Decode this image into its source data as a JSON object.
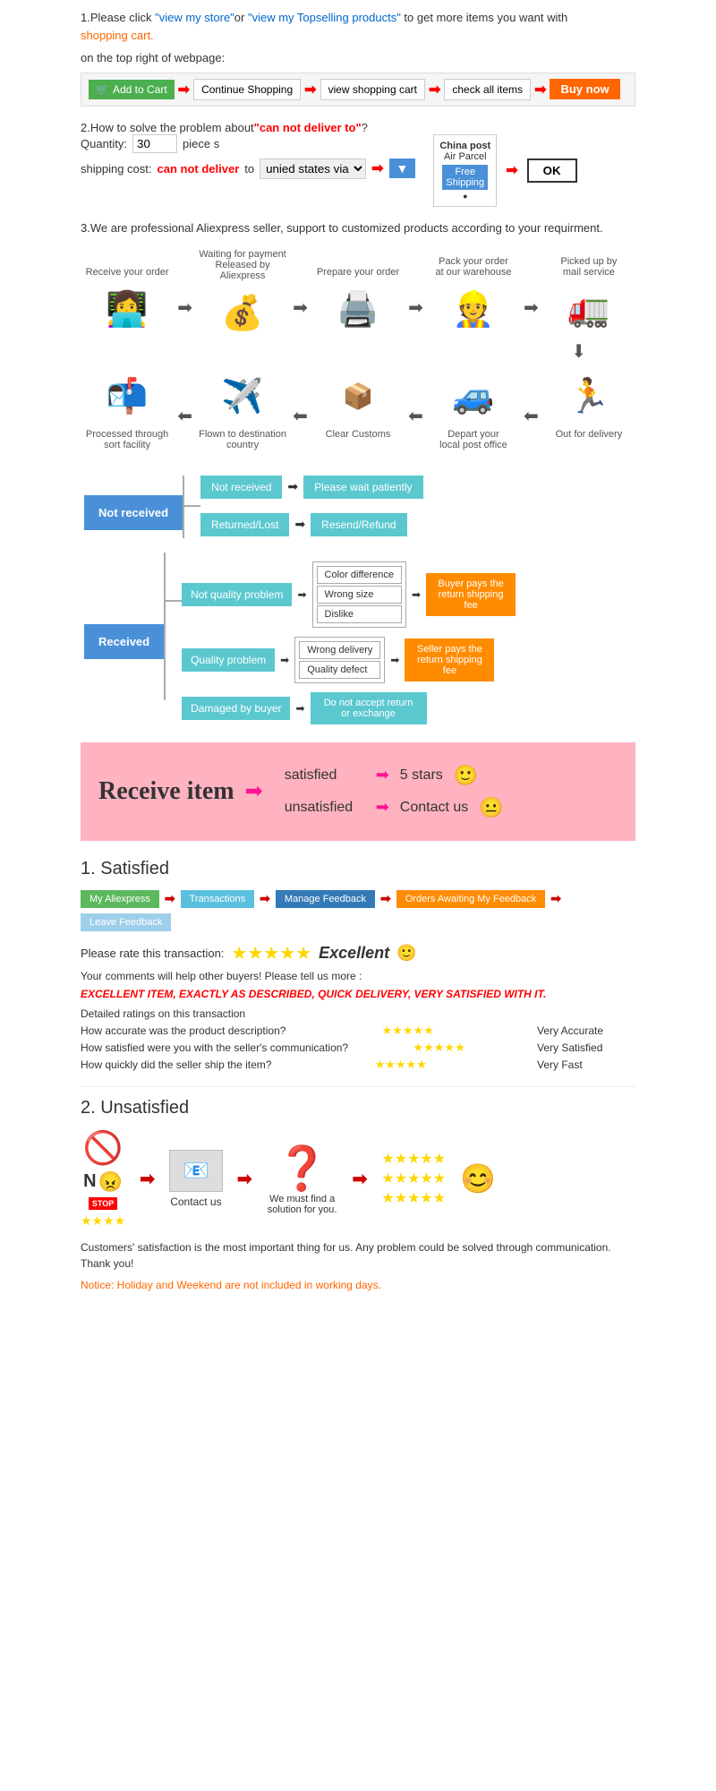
{
  "section1": {
    "text1": "1.Please click ",
    "link1": "\"view my store\"",
    "text2": "or ",
    "link2": "\"view my Topselling products\"",
    "text3": " to get more items you want with",
    "link3": "shopping cart.",
    "text4": "on the top right of webpage:",
    "cart_btn": "Add to Cart",
    "continue_btn": "Continue Shopping",
    "view_cart_btn": "view shopping cart",
    "check_btn": "check all items",
    "buy_btn": "Buy now"
  },
  "section2": {
    "title": "2.How to solve the problem about",
    "cannot": "\"can not deliver to\"",
    "text": "?",
    "quantity_label": "Quantity:",
    "quantity_value": "30",
    "pieces": "piece s",
    "shipping_label": "shipping cost:",
    "can_not": "can not deliver",
    "to": " to ",
    "via": "unied states via",
    "china_post_title": "China post",
    "china_post_sub": "Air Parcel",
    "free_shipping": "Free",
    "shipping_word": "Shipping",
    "ok": "OK"
  },
  "section3": {
    "text": "3.We are professional Aliexpress seller, support to customized products according to your requirment."
  },
  "process_row1": {
    "labels": [
      "Receive your order",
      "Waiting for payment Released by Aliexpress",
      "Prepare your order",
      "Pack your order at our warehouse",
      "Picked up by mail service"
    ],
    "icons": [
      "💻",
      "💰",
      "🖨️",
      "👷",
      "🚛"
    ]
  },
  "process_row2": {
    "labels": [
      "Out for delivery",
      "Depart your local post office",
      "Clear Customs",
      "Flown to destination country",
      "Processed through sort facility"
    ],
    "icons": [
      "🏃",
      "🚗",
      "📦",
      "✈️",
      "📫"
    ]
  },
  "flowchart_not_received": {
    "main": "Not received",
    "branch1": "Not received",
    "result1": "Please wait patiently",
    "branch2": "Returned/Lost",
    "result2": "Resend/Refund"
  },
  "flowchart_received": {
    "main": "Received",
    "branch1_title": "Not quality problem",
    "branch1_items": [
      "Color difference",
      "Wrong size",
      "Dislike"
    ],
    "branch1_result": "Buyer pays the return shipping fee",
    "branch2_title": "Quality problem",
    "branch2_items": [
      "Wrong delivery",
      "Quality defect"
    ],
    "branch2_result": "Seller pays the return shipping fee",
    "branch3_title": "Damaged by buyer",
    "branch3_result": "Do not accept return or exchange"
  },
  "pink_banner": {
    "title": "Receive item",
    "satisfied": "satisfied",
    "unsatisfied": "unsatisfied",
    "result1": "5 stars",
    "result2": "Contact us",
    "emoji1": "🙂",
    "emoji2": "😐"
  },
  "satisfied": {
    "title": "1. Satisfied",
    "steps": [
      "My Aliexpress",
      "Transactions",
      "Manage Feedback",
      "Orders Awaiting My Feedback",
      "Leave Feedback"
    ],
    "rate_label": "Please rate this transaction:",
    "stars": "★★★★★",
    "excellent": "Excellent",
    "smiley": "🙂",
    "comments": "Your comments will help other buyers! Please tell us more :",
    "excellent_text": "EXCELLENT ITEM, EXACTLY AS DESCRIBED, QUICK DELIVERY, VERY SATISFIED WITH IT.",
    "detailed": "Detailed ratings on this transaction",
    "q1": "How accurate was the product description?",
    "q2": "How satisfied were you with the seller's communication?",
    "q3": "How quickly did the seller ship the item?",
    "a1": "Very Accurate",
    "a2": "Very Satisfied",
    "a3": "Very Fast",
    "stars5": "★★★★★"
  },
  "unsatisfied": {
    "title": "2. Unsatisfied",
    "contact_us": "Contact us",
    "solution": "We must find a solution for you.",
    "notice": "Customers' satisfaction is the most important thing for us. Any problem could be solved through communication. Thank you!",
    "holiday_notice": "Notice: Holiday and Weekend are not included in working days."
  }
}
